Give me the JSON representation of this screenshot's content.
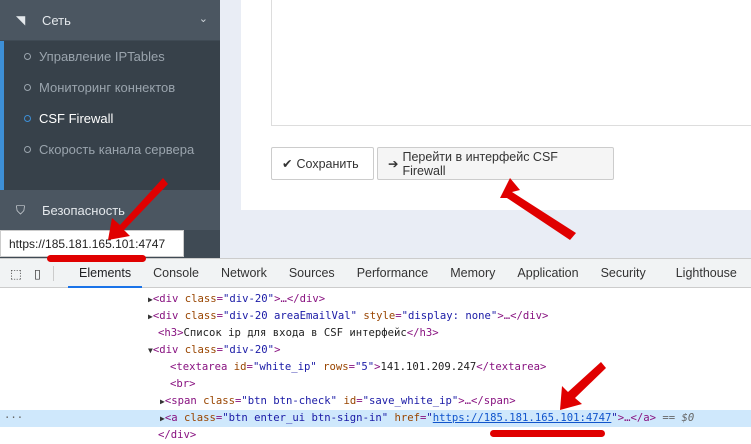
{
  "sidebar": {
    "network": {
      "label": "Сеть",
      "icon": "rss-icon"
    },
    "items": [
      {
        "label": "Управление IPTables"
      },
      {
        "label": "Мониторинг коннектов"
      },
      {
        "label": "CSF Firewall",
        "active": true
      },
      {
        "label": "Скорость канала сервера"
      }
    ],
    "security": {
      "label": "Безопасность",
      "icon": "shield-icon"
    }
  },
  "tooltip": "https://185.181.165.101:4747",
  "buttons": {
    "save": "Сохранить",
    "enter": "Перейти в интерфейс CSF Firewall"
  },
  "devtools": {
    "tabs": [
      "Elements",
      "Console",
      "Network",
      "Sources",
      "Performance",
      "Memory",
      "Application",
      "Security",
      "Lighthouse"
    ],
    "lines": {
      "l1": "div class=\"div-20\">…</div>",
      "l2a": "div",
      "l2b": "class",
      "l2c": "\"div-20 areaEmailVal\"",
      "l2d": "style",
      "l2e": "\"display: none\"",
      "h3": "Список ip для входа в CSF интерфейс",
      "ta_val": "141.101.209.247",
      "href": "https://185.181.165.101:4747",
      "dollar": "== $0"
    }
  },
  "colors": {
    "accent": "#3d8fd6",
    "arrow": "#e00000"
  }
}
